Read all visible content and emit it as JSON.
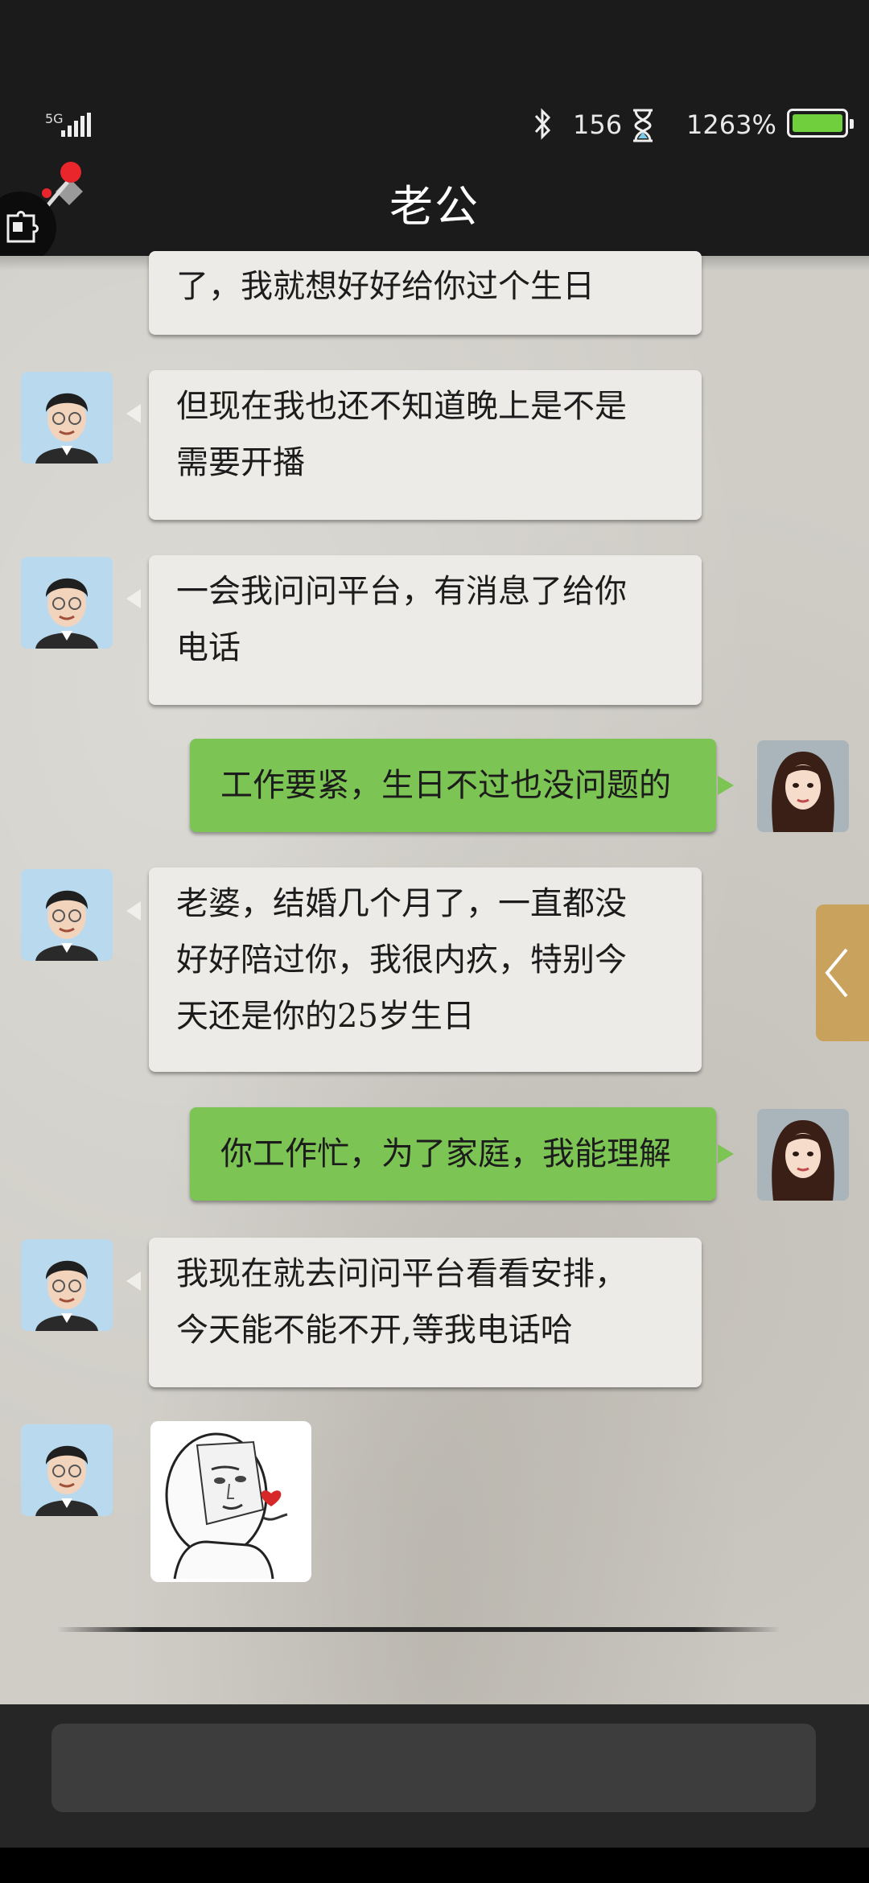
{
  "status_bar": {
    "network": "5G",
    "steps": "156",
    "battery_percent": "1263%",
    "battery_level": 1.0,
    "icons": [
      "signal-icon",
      "bluetooth-icon",
      "hourglass-icon",
      "battery-icon"
    ]
  },
  "header": {
    "title": "老公",
    "left_icons": [
      "pin-icon",
      "puzzle-icon"
    ]
  },
  "messages": [
    {
      "from": "husband",
      "type": "text",
      "text": "了，我就想好好给你过个生日"
    },
    {
      "from": "husband",
      "type": "text",
      "text": "但现在我也还不知道晚上是不是\n需要开播"
    },
    {
      "from": "husband",
      "type": "text",
      "text": "一会我问问平台，有消息了给你\n电话"
    },
    {
      "from": "me",
      "type": "text",
      "text": "工作要紧，生日不过也没问题的"
    },
    {
      "from": "husband",
      "type": "text",
      "text": "老婆，结婚几个月了，一直都没\n好好陪过你，我很内疚，特别今\n天还是你的25岁生日"
    },
    {
      "from": "me",
      "type": "text",
      "text": "你工作忙，为了家庭，我能理解"
    },
    {
      "from": "husband",
      "type": "text",
      "text": "我现在就去问问平台看看安排，\n今天能不能不开,等我电话哈"
    },
    {
      "from": "husband",
      "type": "sticker",
      "icon": "meme-sticker-icon"
    }
  ],
  "side_tab": {
    "icon": "chevron-left-icon"
  },
  "colors": {
    "sent_bubble": "#7cc453",
    "received_bubble": "#ecebe7",
    "header_bg": "#1b1b1b",
    "chat_bg": "#cfcdc6"
  }
}
